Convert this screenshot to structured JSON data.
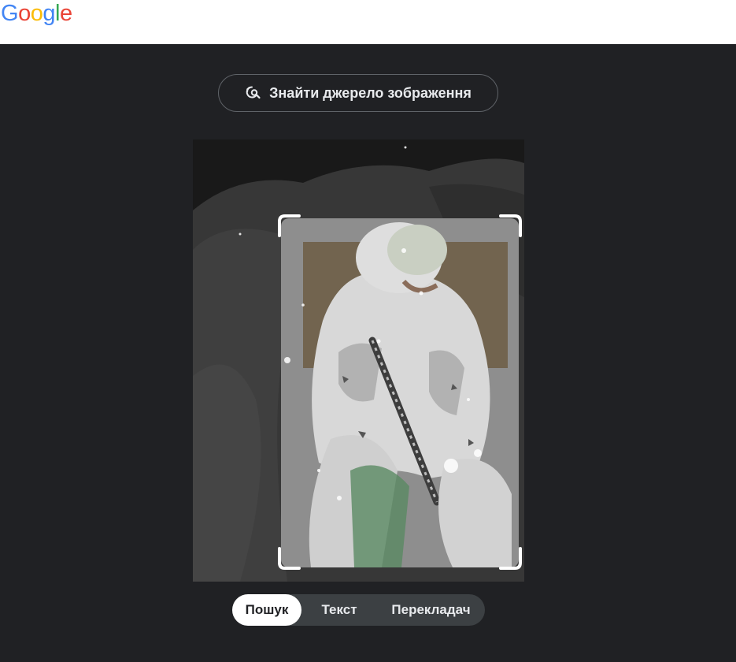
{
  "header": {
    "logo_letters": [
      "G",
      "o",
      "o",
      "g",
      "l",
      "e"
    ],
    "logo_colors": [
      "#4285F4",
      "#EA4335",
      "#FBBC05",
      "#4285F4",
      "#34A853",
      "#EA4335"
    ]
  },
  "source_button": {
    "label": "Знайти джерело зображення",
    "icon": "lens-search-icon"
  },
  "image": {
    "subject": "uploaded-photo",
    "crop_frame": "selection-frame"
  },
  "tabs": [
    {
      "label": "Пошук",
      "active": true
    },
    {
      "label": "Текст",
      "active": false
    },
    {
      "label": "Перекладач",
      "active": false
    }
  ],
  "colors": {
    "background": "#202124",
    "topbar": "#ffffff",
    "tab_bar": "#3c4043",
    "active_tab": "#ffffff"
  }
}
